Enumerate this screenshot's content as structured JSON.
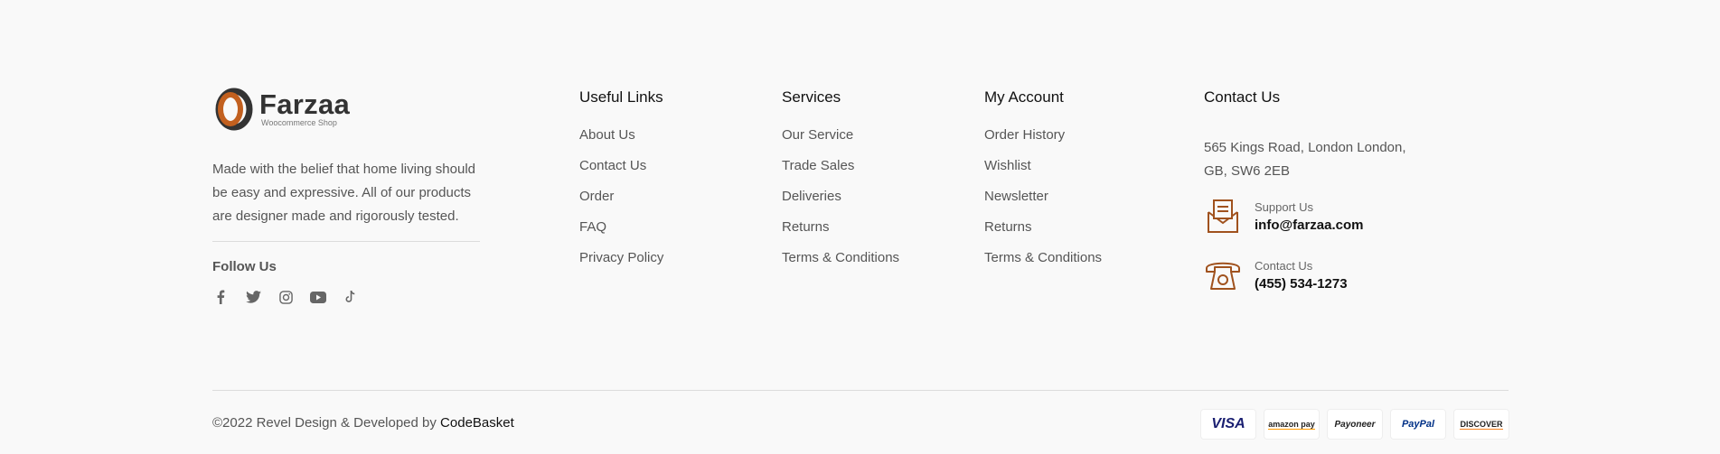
{
  "brand": {
    "name": "Farzaa",
    "tagline": "Woocommerce Shop",
    "about": "Made with the belief that home living should be easy and expressive. All of our products are designer made and rigorously tested.",
    "follow_title": "Follow Us",
    "social_icons": [
      "facebook-icon",
      "twitter-icon",
      "instagram-icon",
      "youtube-icon",
      "tiktok-icon"
    ]
  },
  "useful_links": {
    "title": "Useful Links",
    "items": [
      "About Us",
      "Contact Us",
      "Order",
      "FAQ",
      "Privacy Policy"
    ]
  },
  "services": {
    "title": "Services",
    "items": [
      "Our Service",
      "Trade Sales",
      "Deliveries",
      "Returns",
      "Terms & Conditions"
    ]
  },
  "my_account": {
    "title": "My Account",
    "items": [
      "Order History",
      "Wishlist",
      "Newsletter",
      "Returns",
      "Terms & Conditions"
    ]
  },
  "contact": {
    "title": "Contact Us",
    "address": "565 Kings Road, London London, GB, SW6 2EB",
    "support_label": "Support Us",
    "support_value": "info@farzaa.com",
    "phone_label": "Contact Us",
    "phone_value": "(455) 534-1273"
  },
  "footer": {
    "copyright_prefix": "©2022 Revel Design & Developed by ",
    "copyright_brand": "CodeBasket",
    "payments": [
      "VISA",
      "amazon pay",
      "Payoneer",
      "PayPal",
      "DISCOVER"
    ]
  },
  "colors": {
    "accent": "#a0521e",
    "background": "#f9f9f9",
    "text": "#555555",
    "heading": "#111111"
  }
}
